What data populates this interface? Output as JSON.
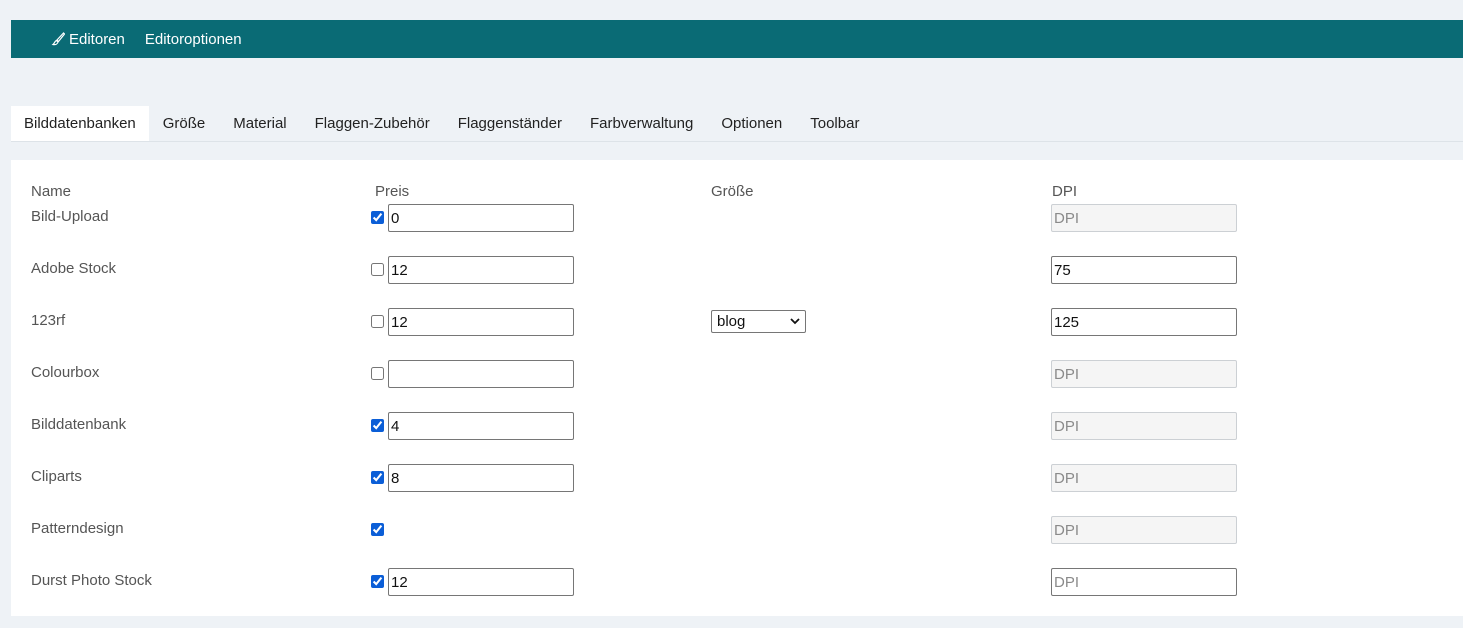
{
  "topnav": {
    "items": [
      {
        "label": "Editoren",
        "icon": "brush-icon"
      },
      {
        "label": "Editoroptionen"
      }
    ]
  },
  "tabs": [
    {
      "label": "Bilddatenbanken",
      "active": true
    },
    {
      "label": "Größe"
    },
    {
      "label": "Material"
    },
    {
      "label": "Flaggen-Zubehör"
    },
    {
      "label": "Flaggenständer"
    },
    {
      "label": "Farbverwaltung"
    },
    {
      "label": "Optionen"
    },
    {
      "label": "Toolbar"
    }
  ],
  "table": {
    "headers": {
      "name": "Name",
      "price": "Preis",
      "size": "Größe",
      "dpi": "DPI"
    },
    "dpi_placeholder": "DPI",
    "rows": [
      {
        "name": "Bild-Upload",
        "checked": true,
        "price": "0",
        "dpi": "",
        "dpi_disabled": true
      },
      {
        "name": "Adobe Stock",
        "checked": false,
        "price": "12",
        "dpi": "75",
        "dpi_disabled": false
      },
      {
        "name": "123rf",
        "checked": false,
        "price": "12",
        "size": "blog",
        "dpi": "125",
        "dpi_disabled": false
      },
      {
        "name": "Colourbox",
        "checked": false,
        "price": "",
        "dpi": "",
        "dpi_disabled": true
      },
      {
        "name": "Bilddatenbank",
        "checked": true,
        "price": "4",
        "dpi": "",
        "dpi_disabled": true
      },
      {
        "name": "Cliparts",
        "checked": true,
        "price": "8",
        "dpi": "",
        "dpi_disabled": true
      },
      {
        "name": "Patterndesign",
        "checked": true,
        "no_price": true,
        "dpi": "",
        "dpi_disabled": true
      },
      {
        "name": "Durst Photo Stock",
        "checked": true,
        "price": "12",
        "dpi": "",
        "dpi_disabled": false
      }
    ]
  },
  "colors": {
    "topbar": "#0a6b75",
    "checkbox": "#0b5ed7"
  }
}
